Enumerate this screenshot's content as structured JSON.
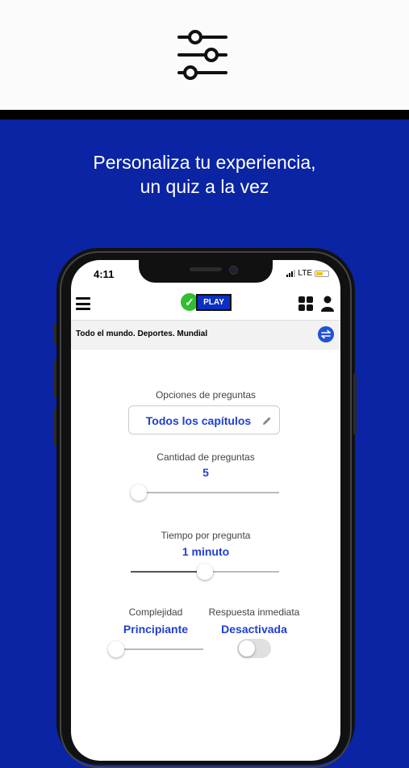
{
  "promo": {
    "line1": "Personaliza tu experiencia,",
    "line2": "un quiz a la vez"
  },
  "status_bar": {
    "time": "4:11",
    "network": "LTE"
  },
  "app_bar": {
    "logo_text": "PLAY",
    "logo_mark": "✓"
  },
  "breadcrumb": "Todo el mundo. Deportes. Mundial",
  "options": {
    "question_options_label": "Opciones de preguntas",
    "question_options_value": "Todos los capítulos",
    "question_count_label": "Cantidad de preguntas",
    "question_count_value": "5",
    "question_count_level": 0.0,
    "time_label": "Tiempo por pregunta",
    "time_value": "1 minuto",
    "time_level": 0.5,
    "complexity_label": "Complejidad",
    "complexity_value": "Principiante",
    "complexity_level": 0.0,
    "immediate_label": "Respuesta inmediata",
    "immediate_value": "Desactivada",
    "immediate_on": false
  },
  "colors": {
    "brand_blue": "#0a24a3",
    "accent_blue": "#1f3fd1",
    "logo_green": "#2fbf2f"
  },
  "icons": [
    "settings-sliders-icon",
    "hamburger-menu-icon",
    "grid-icon",
    "user-icon",
    "swap-icon",
    "pencil-icon"
  ]
}
